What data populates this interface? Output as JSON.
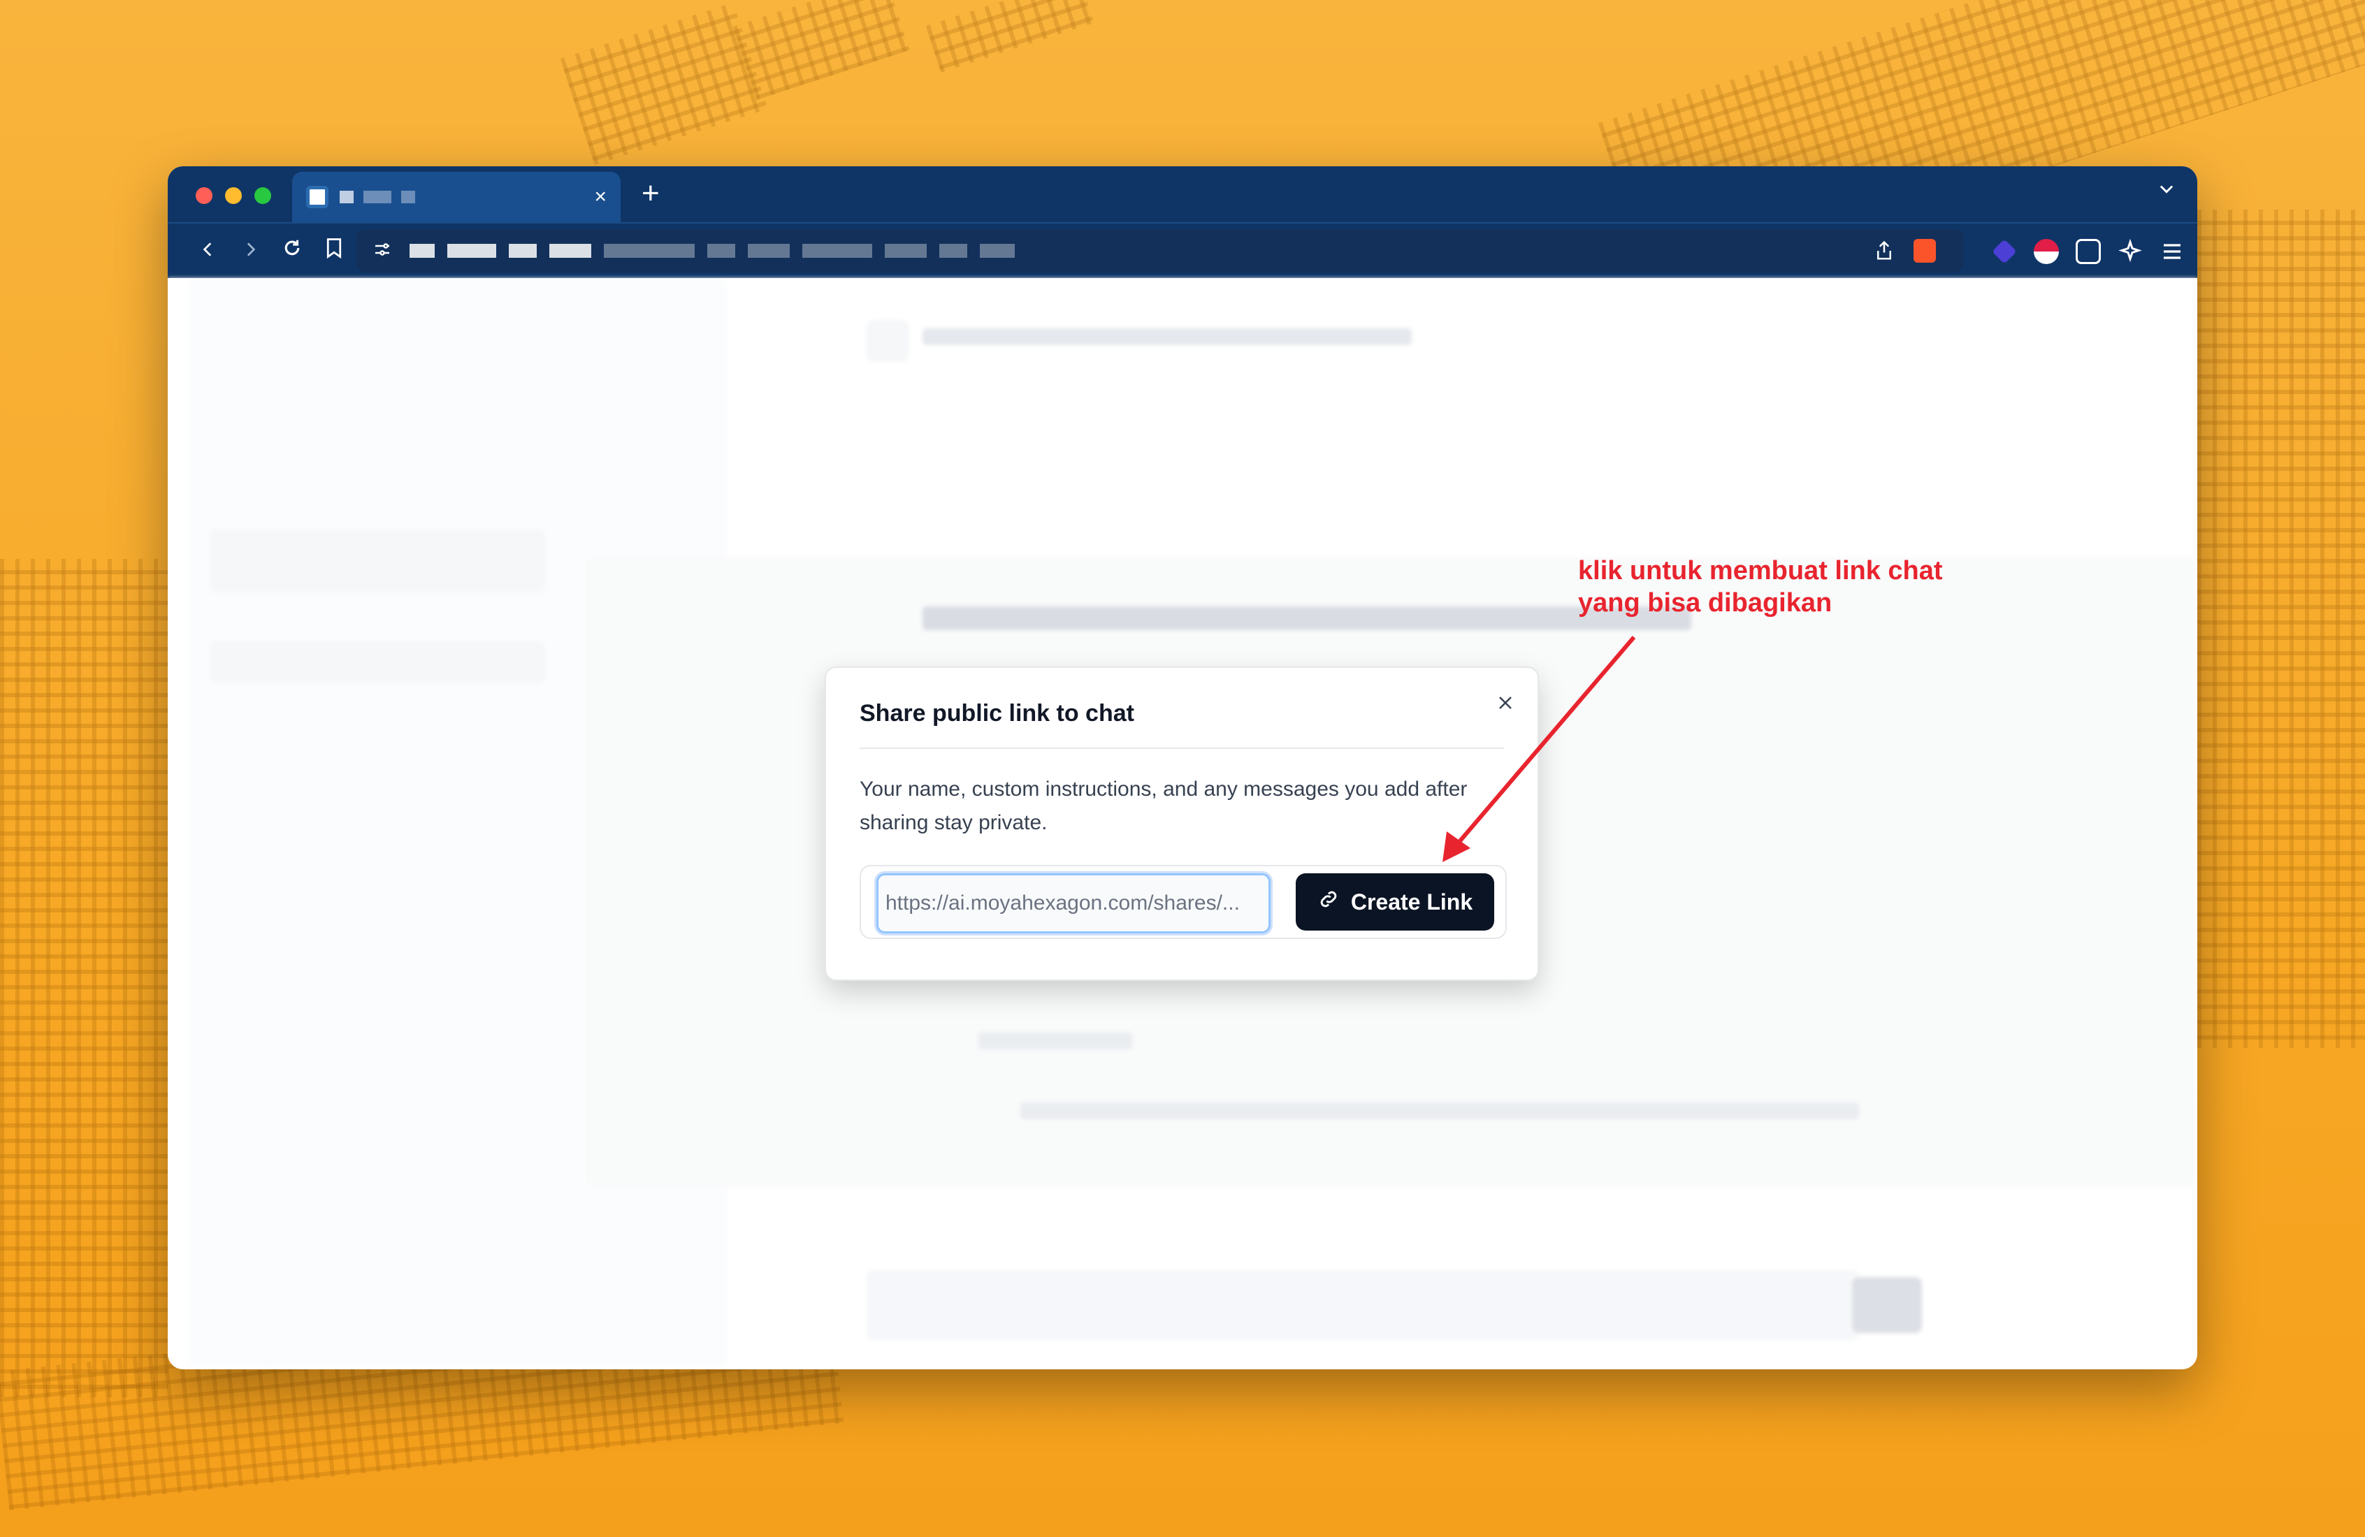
{
  "browser": {
    "tab_close": "×",
    "new_tab": "+",
    "tab_list_chevron": "⌄",
    "nav": {
      "back": "‹",
      "forward": "›",
      "reload": "↻",
      "bookmark": "⌑"
    }
  },
  "modal": {
    "title": "Share public link to chat",
    "close_label": "×",
    "description": "Your name, custom instructions, and any messages you add after sharing stay private.",
    "link_value": "https://ai.moyahexagon.com/shares/...",
    "create_button": "Create Link",
    "link_icon": "link-icon"
  },
  "annotation": {
    "line1": "klik untuk membuat link chat",
    "line2": "yang bisa dibagikan",
    "color": "#e8242e"
  },
  "colors": {
    "browser_chrome": "#0f3566",
    "button_dark": "#0b1424",
    "background": "#f7a825"
  }
}
